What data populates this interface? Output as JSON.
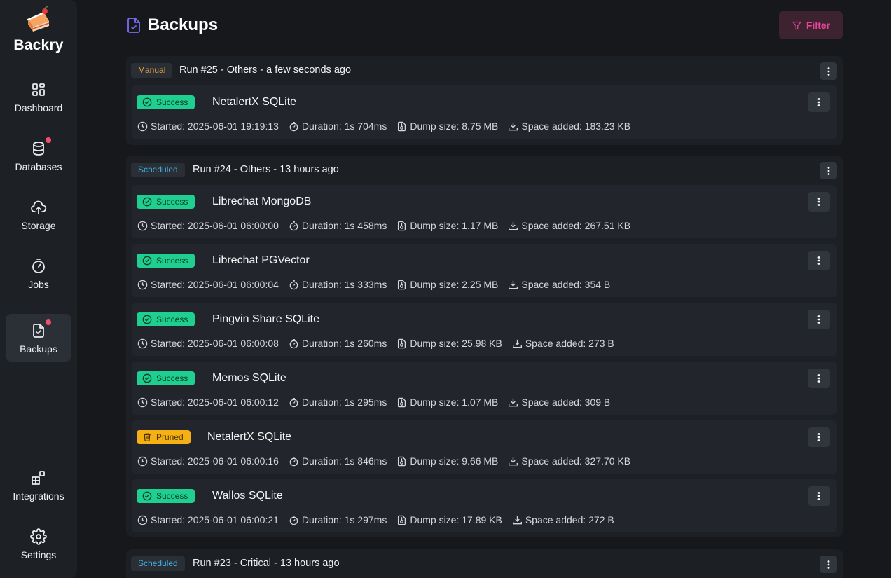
{
  "app": {
    "name": "Backry"
  },
  "sidebar": {
    "items": [
      {
        "label": "Dashboard",
        "icon": "dashboard-icon",
        "active": false,
        "dot": false
      },
      {
        "label": "Databases",
        "icon": "database-icon",
        "active": false,
        "dot": true
      },
      {
        "label": "Storage",
        "icon": "cloud-upload-icon",
        "active": false,
        "dot": false
      },
      {
        "label": "Jobs",
        "icon": "stopwatch-icon",
        "active": false,
        "dot": false
      },
      {
        "label": "Backups",
        "icon": "file-check-icon",
        "active": true,
        "dot": true
      }
    ],
    "bottom": [
      {
        "label": "Integrations",
        "icon": "integrations-icon"
      },
      {
        "label": "Settings",
        "icon": "gear-icon"
      }
    ]
  },
  "header": {
    "title": "Backups",
    "filter_label": "Filter"
  },
  "colors": {
    "success": "#1fcf8f",
    "pruned": "#f5b014",
    "manual": "#e8a93a",
    "scheduled": "#3fb3e6",
    "accent": "#e8449a",
    "notification": "#f0506e"
  },
  "runs": [
    {
      "type": "Manual",
      "title": "Run #25 - Others - a few seconds ago",
      "jobs": [
        {
          "status": "Success",
          "name": "NetalertX SQLite",
          "started": "Started: 2025-06-01 19:19:13",
          "duration": "Duration: 1s 704ms",
          "dump_size": "Dump size: 8.75 MB",
          "space_added": "Space added: 183.23 KB"
        }
      ]
    },
    {
      "type": "Scheduled",
      "title": "Run #24 - Others - 13 hours ago",
      "jobs": [
        {
          "status": "Success",
          "name": "Librechat MongoDB",
          "started": "Started: 2025-06-01 06:00:00",
          "duration": "Duration: 1s 458ms",
          "dump_size": "Dump size: 1.17 MB",
          "space_added": "Space added: 267.51 KB"
        },
        {
          "status": "Success",
          "name": "Librechat PGVector",
          "started": "Started: 2025-06-01 06:00:04",
          "duration": "Duration: 1s 333ms",
          "dump_size": "Dump size: 2.25 MB",
          "space_added": "Space added: 354 B"
        },
        {
          "status": "Success",
          "name": "Pingvin Share SQLite",
          "started": "Started: 2025-06-01 06:00:08",
          "duration": "Duration: 1s 260ms",
          "dump_size": "Dump size: 25.98 KB",
          "space_added": "Space added: 273 B"
        },
        {
          "status": "Success",
          "name": "Memos SQLite",
          "started": "Started: 2025-06-01 06:00:12",
          "duration": "Duration: 1s 295ms",
          "dump_size": "Dump size: 1.07 MB",
          "space_added": "Space added: 309 B"
        },
        {
          "status": "Pruned",
          "name": "NetalertX SQLite",
          "started": "Started: 2025-06-01 06:00:16",
          "duration": "Duration: 1s 846ms",
          "dump_size": "Dump size: 9.66 MB",
          "space_added": "Space added: 327.70 KB"
        },
        {
          "status": "Success",
          "name": "Wallos SQLite",
          "started": "Started: 2025-06-01 06:00:21",
          "duration": "Duration: 1s 297ms",
          "dump_size": "Dump size: 17.89 KB",
          "space_added": "Space added: 272 B"
        }
      ]
    },
    {
      "type": "Scheduled",
      "title": "Run #23 - Critical - 13 hours ago",
      "jobs": []
    }
  ]
}
